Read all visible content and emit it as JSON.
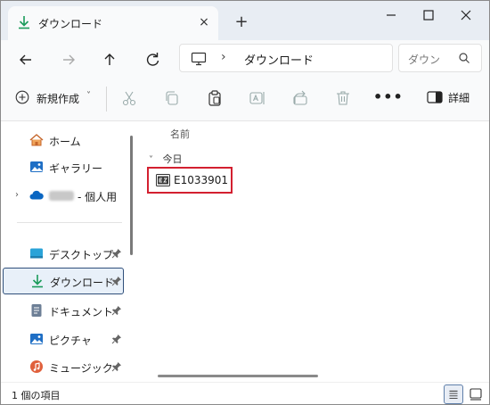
{
  "tab": {
    "title": "ダウンロード",
    "close_glyph": "×"
  },
  "new_tab_glyph": "+",
  "window_controls": {
    "minimize_glyph": "—",
    "maximize_glyph": "☐",
    "close_glyph": "✕"
  },
  "address": {
    "separator": "›",
    "crumb": "ダウンロード"
  },
  "search": {
    "placeholder": "ダウン"
  },
  "toolbar": {
    "new_label": "新規作成",
    "new_dropdown_glyph": "˅",
    "more_glyph": "•••",
    "details_label": "詳細"
  },
  "sidebar": {
    "items": [
      {
        "label": "ホーム",
        "icon": "home-icon"
      },
      {
        "label": "ギャラリー",
        "icon": "gallery-icon"
      },
      {
        "label": "- 個人用",
        "icon": "onedrive-icon",
        "expand_glyph": "›"
      },
      {
        "label": "デスクトップ",
        "icon": "desktop-icon",
        "pinned": true
      },
      {
        "label": "ダウンロード",
        "icon": "download-icon",
        "pinned": true,
        "selected": true
      },
      {
        "label": "ドキュメント",
        "icon": "documents-icon",
        "pinned": true
      },
      {
        "label": "ピクチャ",
        "icon": "pictures-icon",
        "pinned": true
      },
      {
        "label": "ミュージック",
        "icon": "music-icon",
        "pinned": true
      }
    ]
  },
  "content": {
    "column_name": "名前",
    "group_chevron": "˅",
    "group_label": "今日",
    "files": [
      {
        "name": "E1033901",
        "icon": "exe-file-icon"
      }
    ]
  },
  "status": {
    "text": "1 個の項目"
  },
  "colors": {
    "accent": "#0067c0",
    "download_green": "#1a9b5a",
    "highlight_red": "#d32030",
    "titlebar_bg": "#e8edf3",
    "selected_bg": "#e8f0f9"
  }
}
